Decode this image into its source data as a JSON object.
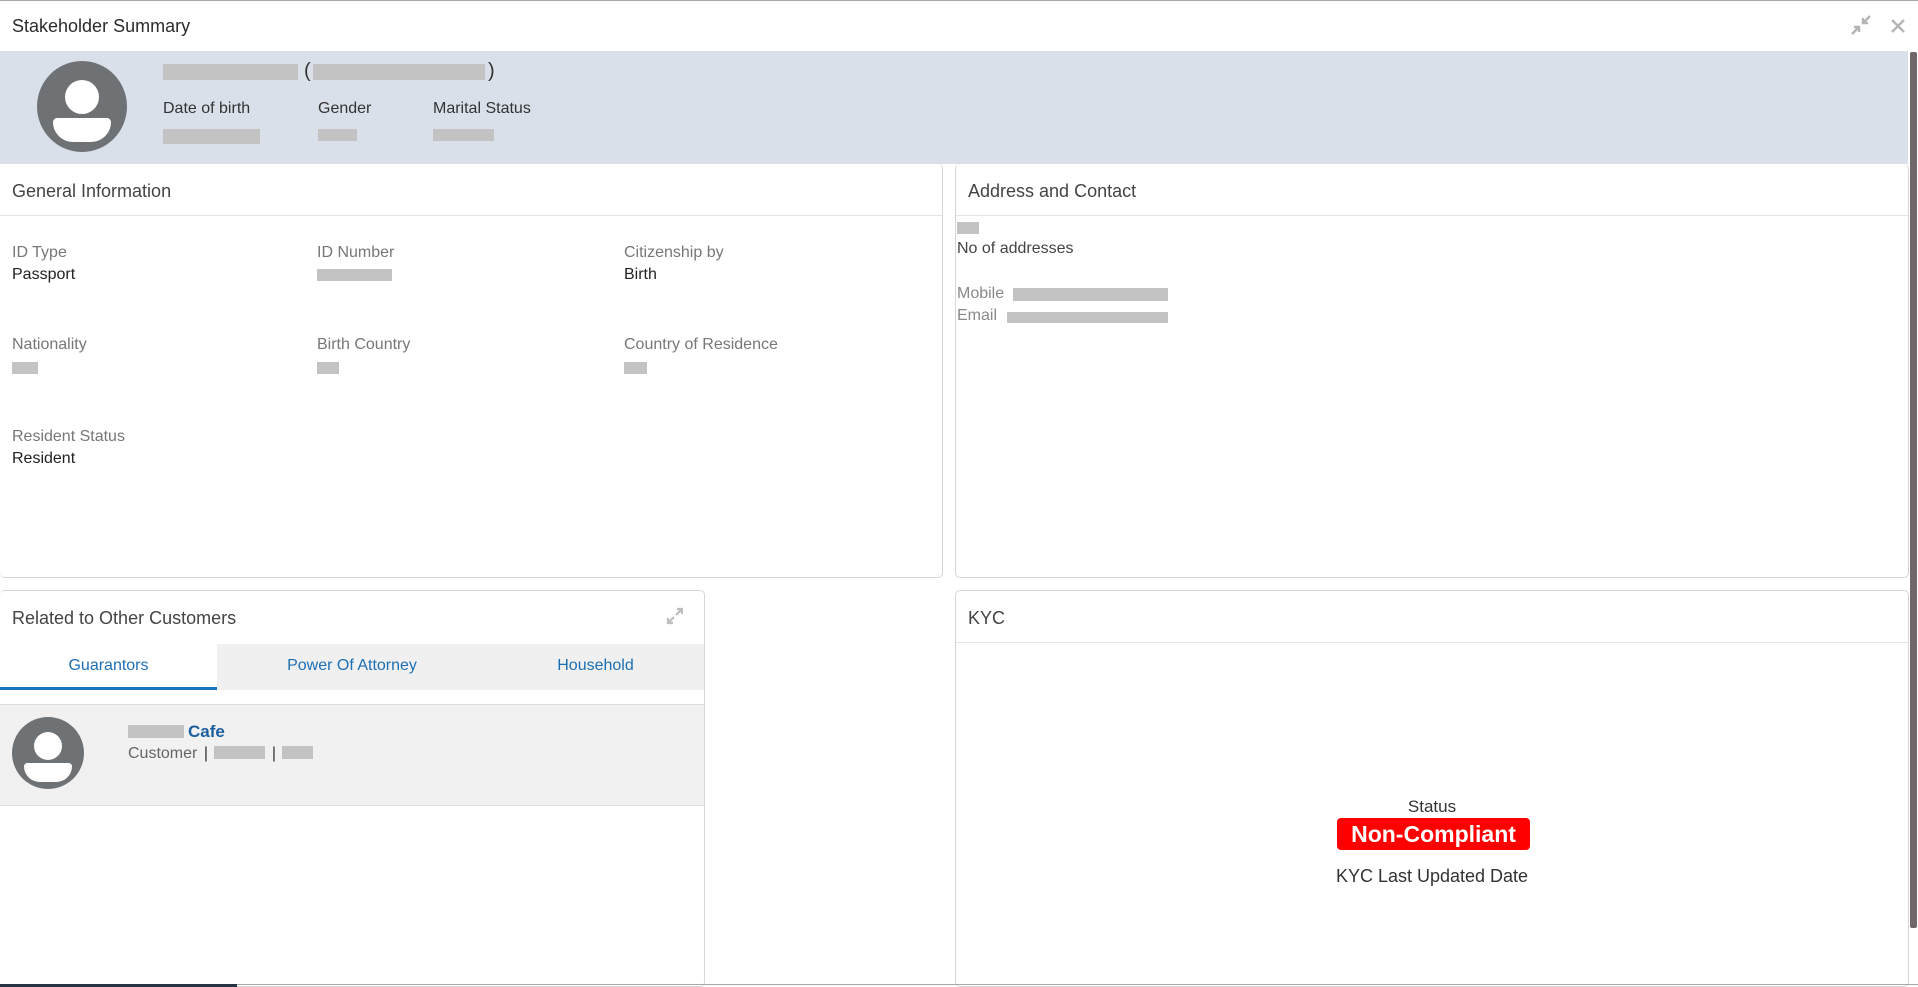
{
  "window": {
    "title": "Stakeholder Summary",
    "restore_icon": "collapse-arrows-icon",
    "close_icon": "close-icon"
  },
  "header": {
    "avatar_icon": "user-avatar-icon",
    "name": "[redacted]",
    "customer_id": "[redacted]",
    "open_paren": "(",
    "close_paren": ")",
    "fields": [
      {
        "label": "Date of birth",
        "value": "[redacted]"
      },
      {
        "label": "Gender",
        "value": "[redacted]"
      },
      {
        "label": "Marital Status",
        "value": "[redacted]"
      }
    ]
  },
  "general_information": {
    "title": "General Information",
    "fields": [
      {
        "label": "ID Type",
        "value": "Passport"
      },
      {
        "label": "ID Number",
        "value": "[redacted]"
      },
      {
        "label": "Citizenship by",
        "value": "Birth"
      },
      {
        "label": "Nationality",
        "value": "[redacted]"
      },
      {
        "label": "Birth Country",
        "value": "[redacted]"
      },
      {
        "label": "Country of Residence",
        "value": "[redacted]"
      },
      {
        "label": "Resident Status",
        "value": "Resident"
      }
    ]
  },
  "address_contact": {
    "title": "Address and Contact",
    "address_count": "[redacted]",
    "address_count_label": "No of addresses",
    "mobile_label": "Mobile",
    "mobile_value": "[redacted]",
    "email_label": "Email",
    "email_value": "[redacted]"
  },
  "related": {
    "title": "Related to Other Customers",
    "expand_icon": "expand-arrows-icon",
    "tabs": [
      {
        "label": "Guarantors",
        "active": true
      },
      {
        "label": "Power Of Attorney",
        "active": false
      },
      {
        "label": "Household",
        "active": false
      }
    ],
    "items": [
      {
        "name": "Cafe",
        "name_prefix": "[redacted]",
        "type": "Customer",
        "separator": "|",
        "detail1": "[redacted]",
        "detail2": "[redacted]"
      }
    ]
  },
  "kyc": {
    "title": "KYC",
    "status_label": "Status",
    "status_value": "Non-Compliant",
    "status_color": "#ff0000",
    "last_updated_label": "KYC Last Updated Date"
  },
  "colors": {
    "header_band": "#d9e0ea",
    "accent_blue": "#1a75c0",
    "link_blue": "#1d5f9e"
  }
}
